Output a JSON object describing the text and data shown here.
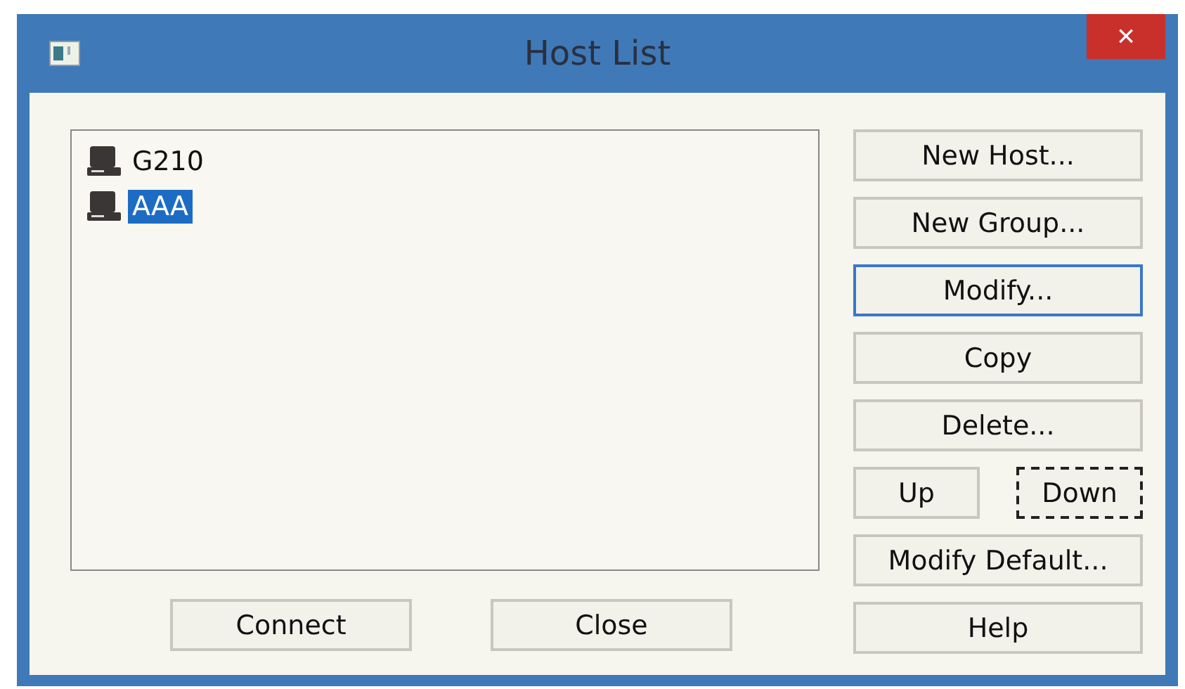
{
  "window": {
    "title": "Host List",
    "close": "×"
  },
  "hosts": [
    {
      "label": "G210",
      "selected": false
    },
    {
      "label": "AAA",
      "selected": true
    }
  ],
  "side_buttons": [
    [
      {
        "label": "New Host...",
        "default": false,
        "focused": false
      }
    ],
    [
      {
        "label": "New Group...",
        "default": false,
        "focused": false
      }
    ],
    [
      {
        "label": "Modify...",
        "default": true,
        "focused": false
      }
    ],
    [
      {
        "label": "Copy",
        "default": false,
        "focused": false
      }
    ],
    [
      {
        "label": "Delete...",
        "default": false,
        "focused": false
      }
    ],
    [
      {
        "label": "Up",
        "default": false,
        "focused": false
      },
      {
        "label": "Down",
        "default": false,
        "focused": true
      }
    ],
    [
      {
        "label": "Modify Default...",
        "default": false,
        "focused": false
      }
    ],
    [
      {
        "label": "Help",
        "default": false,
        "focused": false
      }
    ]
  ],
  "bottom_buttons": [
    {
      "label": "Connect"
    },
    {
      "label": "Close"
    }
  ]
}
